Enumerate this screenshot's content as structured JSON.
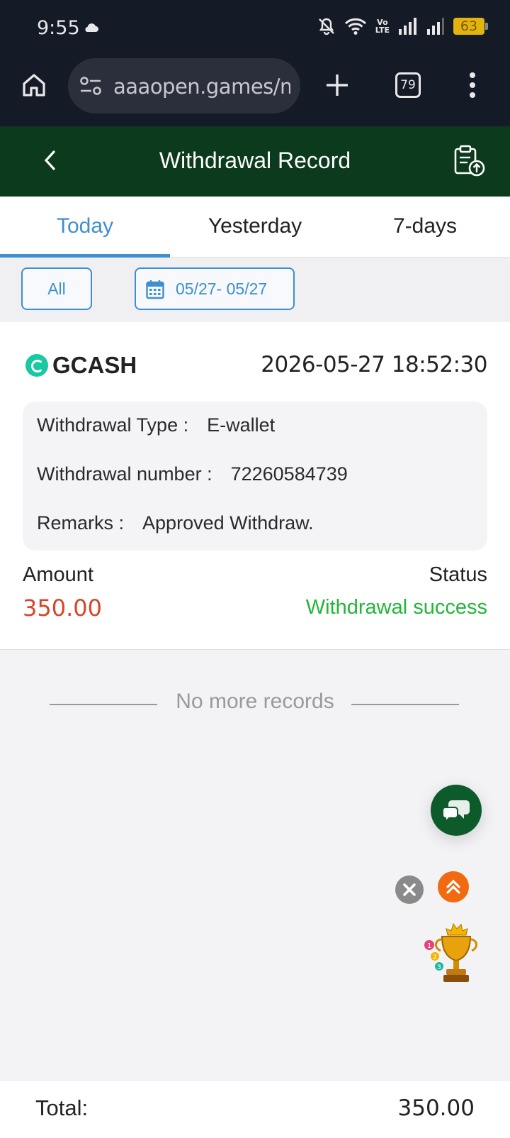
{
  "status_bar": {
    "time": "9:55",
    "network_label": "Vo\nLTE",
    "battery": "63"
  },
  "browser": {
    "url": "aaaopen.games/m/",
    "tab_count": "79"
  },
  "header": {
    "title": "Withdrawal Record"
  },
  "tabs": [
    {
      "label": "Today",
      "active": true
    },
    {
      "label": "Yesterday",
      "active": false
    },
    {
      "label": "7-days",
      "active": false
    }
  ],
  "filters": {
    "type_label": "All",
    "date_range": "05/27- 05/27"
  },
  "record": {
    "provider": "GCASH",
    "datetime": "2026-05-27 18:52:30",
    "type_label": "Withdrawal Type :",
    "type_value": "E-wallet",
    "number_label": "Withdrawal number :",
    "number_value": "72260584739",
    "remarks_label": "Remarks :",
    "remarks_value": "Approved Withdraw.",
    "amount_label": "Amount",
    "amount_value": "350.00",
    "status_label": "Status",
    "status_value": "Withdrawal success"
  },
  "no_more": "No more records",
  "total": {
    "label": "Total:",
    "value": "350.00"
  },
  "colors": {
    "header_bg": "#0b3a1d",
    "accent": "#3f8fd0",
    "amount": "#d8442a",
    "success": "#22b537"
  }
}
